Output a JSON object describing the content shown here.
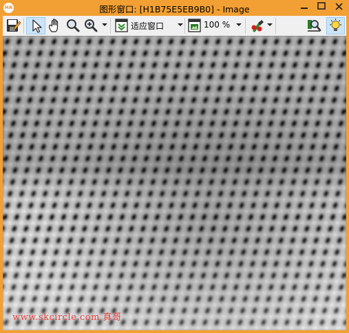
{
  "window": {
    "app_icon_text": "HA",
    "title": "图形窗口: [H1B75E5EB9B0] - Image",
    "frame_color": "#f2a033"
  },
  "toolbar": {
    "zoom_mode_value": "适应窗口",
    "zoom_percent_value": "100 %",
    "icons": [
      "save-icon",
      "pointer-icon",
      "hand-pan-icon",
      "magnifier-icon",
      "zoom-in-icon",
      "fit-window-icon",
      "zoom-percent-icon",
      "color-pencil-icon",
      "inspect-icon",
      "lightbulb-icon"
    ]
  },
  "canvas": {
    "content": "blurred grayscale mesh texture",
    "watermark": "www.skcircle.com 真哥"
  }
}
